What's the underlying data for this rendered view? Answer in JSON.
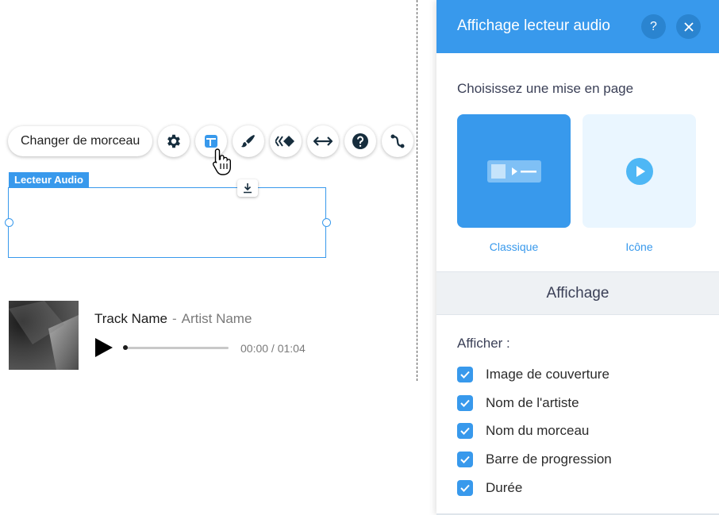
{
  "toolbar": {
    "change_track_label": "Changer de morceau",
    "icons": [
      "gear-icon",
      "layout-icon",
      "paint-brush-icon",
      "animation-icon",
      "stretch-icon",
      "help-icon",
      "connect-icon"
    ]
  },
  "canvas": {
    "element_tag": "Lecteur Audio"
  },
  "player": {
    "track_name": "Track Name",
    "separator": "-",
    "artist_name": "Artist Name",
    "time": "00:00 / 01:04",
    "progress": 0.0
  },
  "panel": {
    "title": "Affichage lecteur audio",
    "help_label": "?",
    "layout_section_label": "Choisissez une mise en page",
    "layouts": [
      {
        "label": "Classique",
        "selected": true
      },
      {
        "label": "Icône",
        "selected": false
      }
    ],
    "display_section_title": "Affichage",
    "show_label": "Afficher :",
    "options": [
      {
        "label": "Image de couverture",
        "checked": true
      },
      {
        "label": "Nom de l'artiste",
        "checked": true
      },
      {
        "label": "Nom du morceau",
        "checked": true
      },
      {
        "label": "Barre de progression",
        "checked": true
      },
      {
        "label": "Durée",
        "checked": true
      }
    ]
  },
  "colors": {
    "accent": "#3899ec",
    "accent_light": "#eaf6ff",
    "band": "#eef1f4"
  }
}
